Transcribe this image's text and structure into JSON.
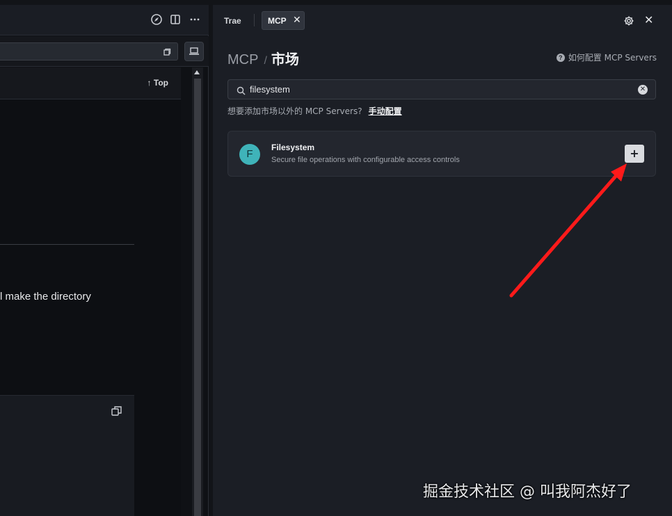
{
  "left": {
    "top_link": "Top",
    "doc_text": "l make the directory"
  },
  "tabs": {
    "trae": "Trae",
    "mcp": "MCP",
    "close_glyph": "✕"
  },
  "breadcrumb": {
    "root": "MCP",
    "separator": "/",
    "current": "市场"
  },
  "help": {
    "icon": "?",
    "label": "如何配置 MCP Servers"
  },
  "search": {
    "value": "filesystem",
    "clear_glyph": "✕"
  },
  "hint": {
    "text": "想要添加市场以外的 MCP Servers?",
    "link": "手动配置"
  },
  "results": [
    {
      "avatar_letter": "F",
      "title": "Filesystem",
      "description": "Secure file operations with configurable access controls",
      "action": "+"
    }
  ],
  "watermark": "掘金技术社区 @ 叫我阿杰好了",
  "colors": {
    "background": "#1b1e25",
    "avatar": "#3fb3b9",
    "arrow": "#ff1a1a"
  }
}
